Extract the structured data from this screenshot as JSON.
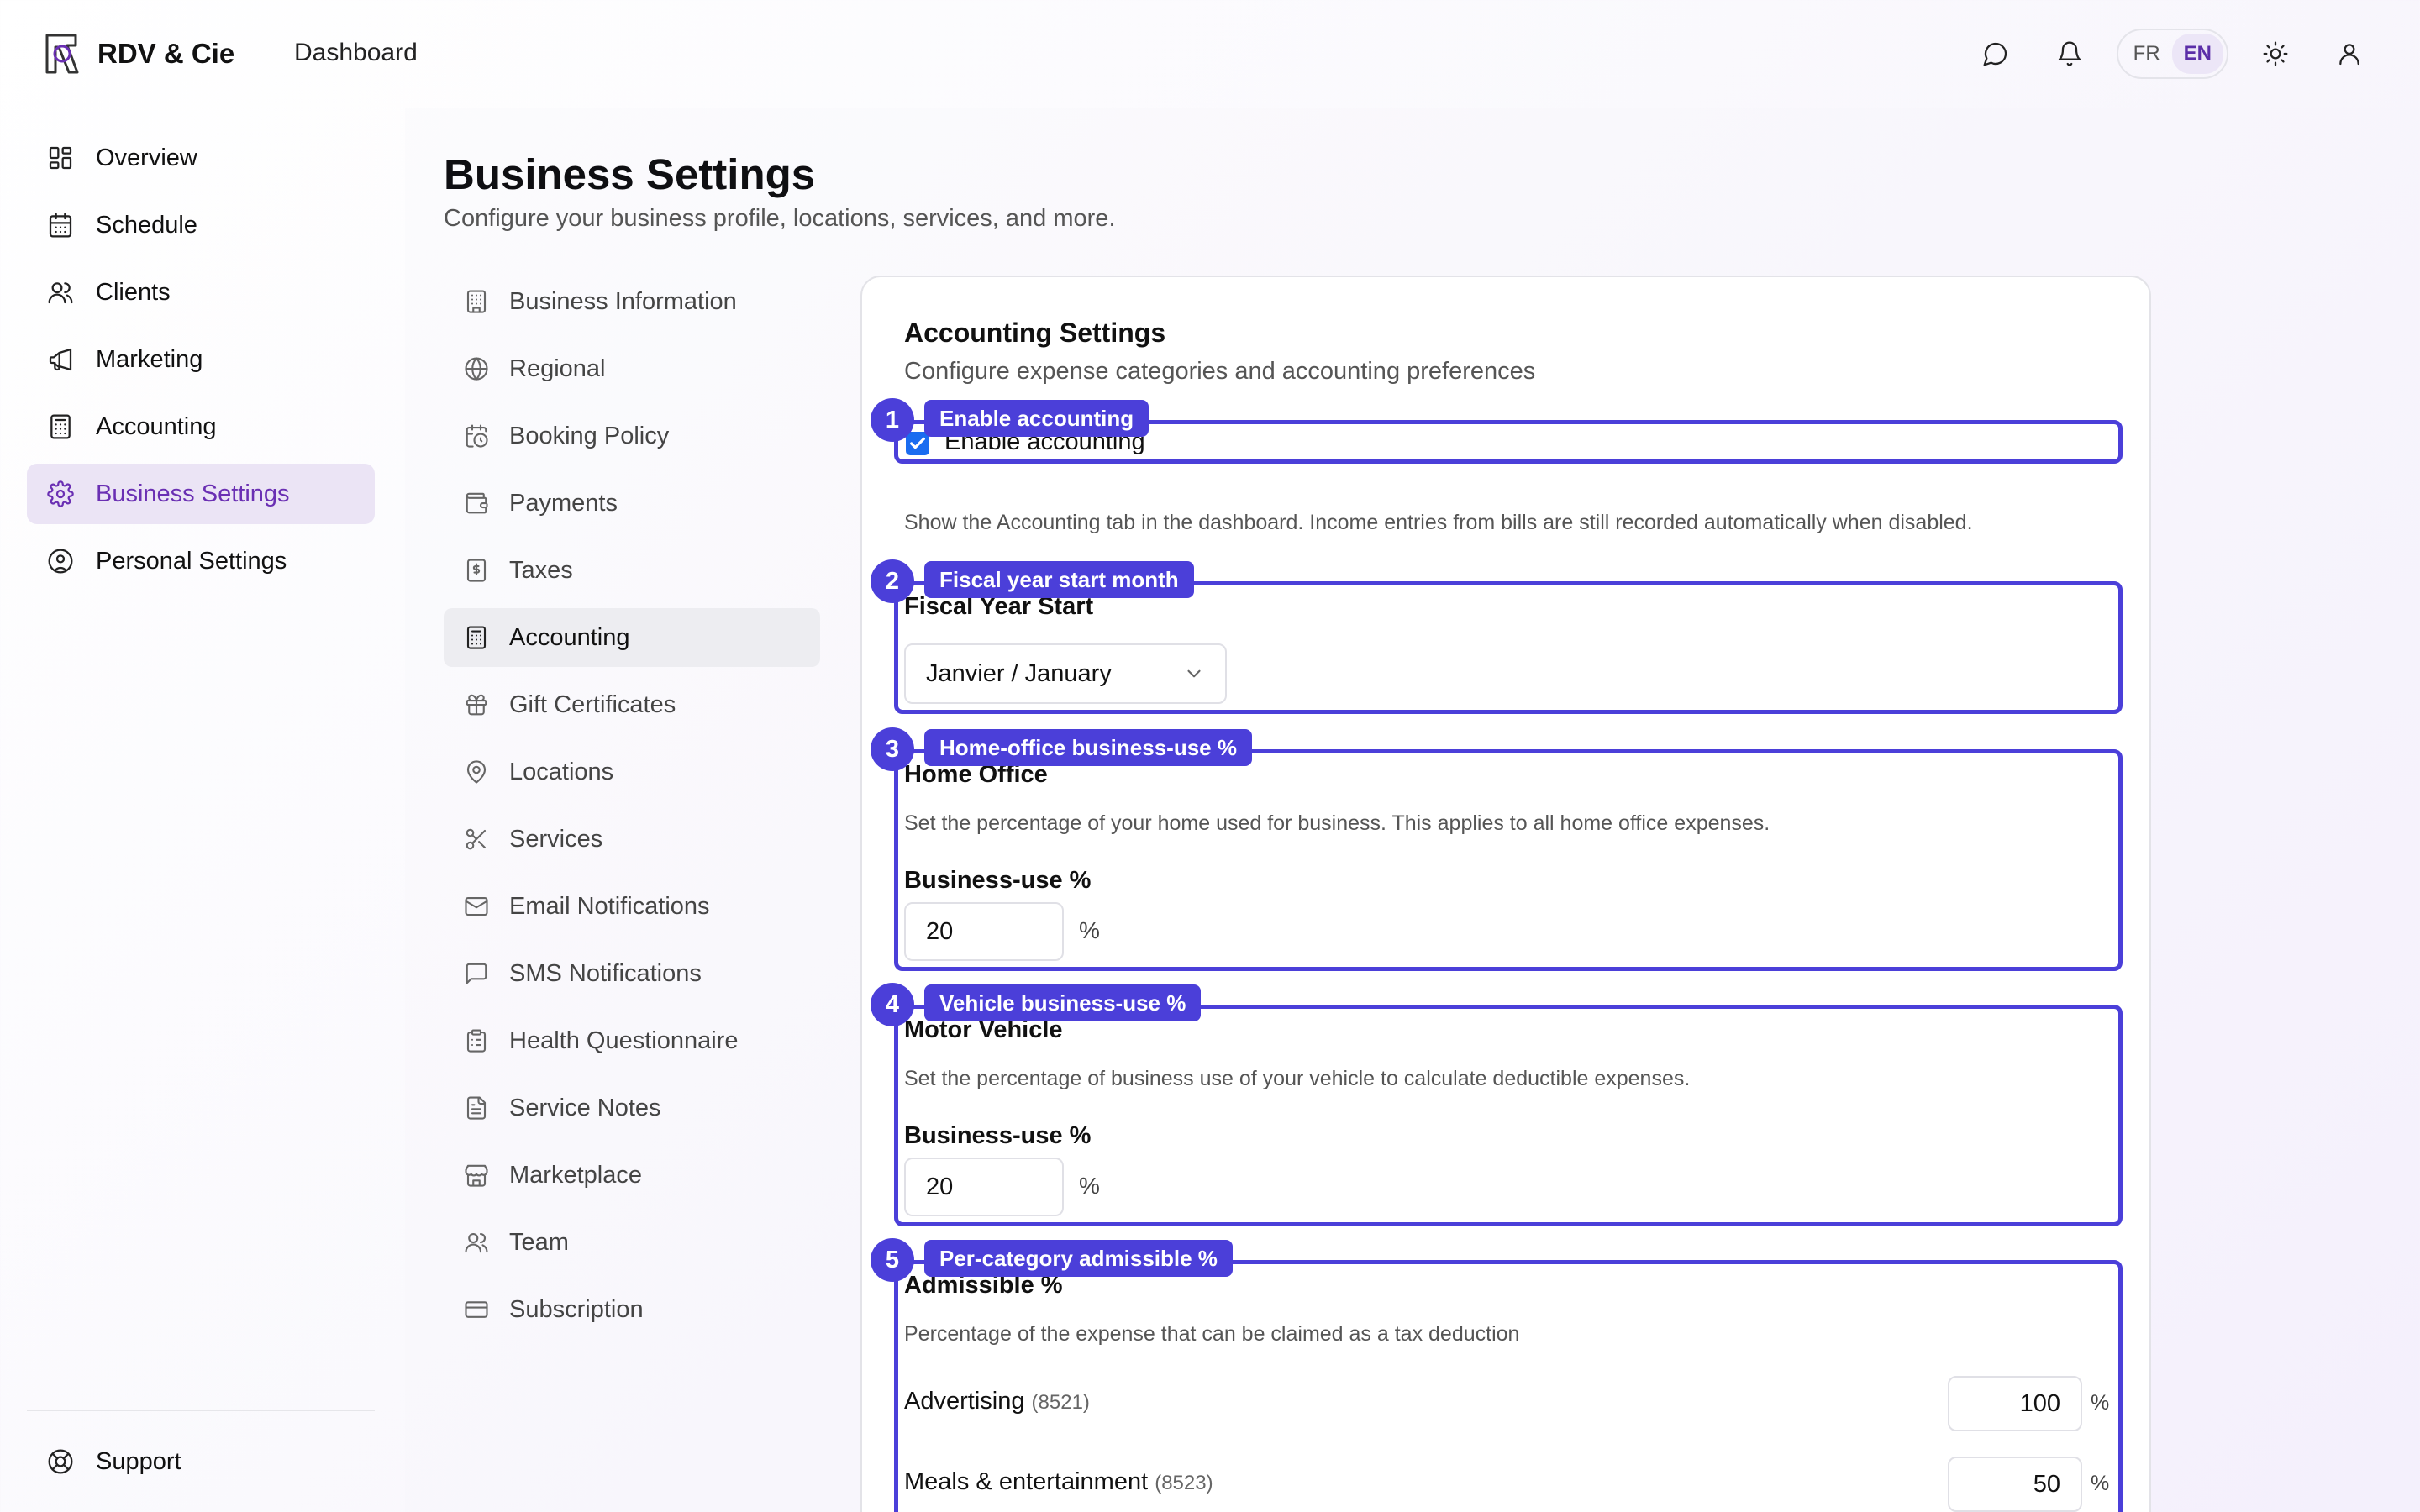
{
  "header": {
    "brand": "RDV & Cie",
    "section": "Dashboard",
    "lang_fr": "FR",
    "lang_en": "EN",
    "icons": [
      "chat-icon",
      "bell-icon",
      "sun-icon",
      "user-icon"
    ]
  },
  "sidebar": {
    "items": [
      {
        "label": "Overview",
        "icon": "grid-icon"
      },
      {
        "label": "Schedule",
        "icon": "calendar-icon"
      },
      {
        "label": "Clients",
        "icon": "users-icon"
      },
      {
        "label": "Marketing",
        "icon": "megaphone-icon"
      },
      {
        "label": "Accounting",
        "icon": "calculator-icon"
      },
      {
        "label": "Business Settings",
        "icon": "gear-icon"
      },
      {
        "label": "Personal Settings",
        "icon": "user-circle-icon"
      }
    ],
    "active": "Business Settings",
    "support": "Support"
  },
  "page": {
    "title": "Business Settings",
    "subtitle": "Configure your business profile, locations, services, and more."
  },
  "subnav": {
    "items": [
      {
        "label": "Business Information",
        "icon": "building-icon"
      },
      {
        "label": "Regional",
        "icon": "globe-icon"
      },
      {
        "label": "Booking Policy",
        "icon": "calendar-clock-icon"
      },
      {
        "label": "Payments",
        "icon": "wallet-icon"
      },
      {
        "label": "Taxes",
        "icon": "receipt-icon"
      },
      {
        "label": "Accounting",
        "icon": "calculator-icon"
      },
      {
        "label": "Gift Certificates",
        "icon": "gift-icon"
      },
      {
        "label": "Locations",
        "icon": "map-pin-icon"
      },
      {
        "label": "Services",
        "icon": "scissors-icon"
      },
      {
        "label": "Email Notifications",
        "icon": "mail-icon"
      },
      {
        "label": "SMS Notifications",
        "icon": "message-square-icon"
      },
      {
        "label": "Health Questionnaire",
        "icon": "clipboard-icon"
      },
      {
        "label": "Service Notes",
        "icon": "file-text-icon"
      },
      {
        "label": "Marketplace",
        "icon": "store-icon"
      },
      {
        "label": "Team",
        "icon": "team-icon"
      },
      {
        "label": "Subscription",
        "icon": "credit-card-icon"
      }
    ],
    "active": "Accounting"
  },
  "card": {
    "title": "Accounting Settings",
    "subtitle": "Configure expense categories and accounting preferences",
    "enable": {
      "badge": "1",
      "tag": "Enable accounting",
      "label": "Enable accounting",
      "checked": true,
      "help": "Show the Accounting tab in the dashboard. Income entries from bills are still recorded automatically when disabled."
    },
    "fiscal": {
      "badge": "2",
      "tag": "Fiscal year start month",
      "label": "Fiscal Year Start",
      "value": "Janvier / January"
    },
    "home_office": {
      "badge": "3",
      "tag": "Home-office business-use %",
      "label": "Home Office",
      "desc": "Set the percentage of your home used for business. This applies to all home office expenses.",
      "field_label": "Business-use %",
      "value": "20",
      "unit": "%"
    },
    "vehicle": {
      "badge": "4",
      "tag": "Vehicle business-use %",
      "label": "Motor Vehicle",
      "desc": "Set the percentage of business use of your vehicle to calculate deductible expenses.",
      "field_label": "Business-use %",
      "value": "20",
      "unit": "%"
    },
    "admissible": {
      "badge": "5",
      "tag": "Per-category admissible %",
      "label": "Admissible %",
      "desc": "Percentage of the expense that can be claimed as a tax deduction",
      "rows": [
        {
          "name": "Advertising",
          "code": "(8521)",
          "value": "100",
          "unit": "%"
        },
        {
          "name": "Meals & entertainment",
          "code": "(8523)",
          "value": "50",
          "unit": "%"
        }
      ]
    }
  },
  "colors": {
    "accent": "#6a2fb3",
    "annotation": "#4b3fd9",
    "checkbox": "#1a6cf0"
  }
}
